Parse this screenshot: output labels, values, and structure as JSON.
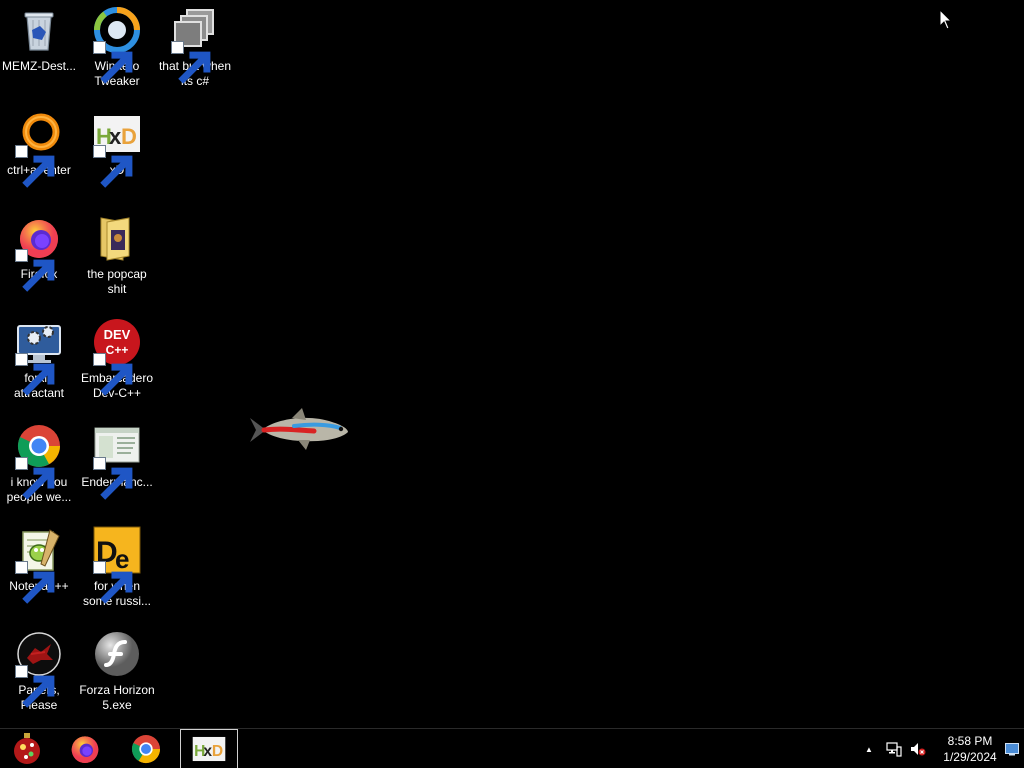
{
  "desktop": {
    "icons": [
      {
        "label": "MEMZ-Dest...",
        "icon": "recycle-bin-icon"
      },
      {
        "label": "Winaero Tweaker",
        "icon": "winaero-icon"
      },
      {
        "label": "that but when its c#",
        "icon": "multiple-windows-icon"
      },
      {
        "label": "ctrl+a, enter",
        "icon": "orange-ring-icon"
      },
      {
        "label": "xD",
        "icon": "hxd-icon"
      },
      {
        "label": "Firefox",
        "icon": "firefox-icon"
      },
      {
        "label": "the popcap shit",
        "icon": "folder-icon"
      },
      {
        "label": "forkie attractant",
        "icon": "settings-monitor-icon"
      },
      {
        "label": "Embarcadero Dev-C++",
        "icon": "devcpp-icon"
      },
      {
        "label": "i know you people we...",
        "icon": "chrome-icon"
      },
      {
        "label": "Endermanc...",
        "icon": "window-app-icon"
      },
      {
        "label": "Notepad++",
        "icon": "notepadpp-icon"
      },
      {
        "label": "for when some russi...",
        "icon": "de-icon"
      },
      {
        "label": "Papers, Please",
        "icon": "papers-please-icon"
      },
      {
        "label": "Forza Horizon 5.exe",
        "icon": "flash-icon"
      }
    ]
  },
  "taskbar": {
    "buttons": [
      {
        "name": "start-button",
        "icon": "ornament-icon"
      },
      {
        "name": "firefox-taskbar-button",
        "icon": "firefox-icon"
      },
      {
        "name": "chrome-taskbar-button",
        "icon": "chrome-icon"
      },
      {
        "name": "hxd-taskbar-button",
        "icon": "hxd-icon",
        "active": true
      }
    ],
    "tray": {
      "chevron": "▲",
      "network_icon": "network-icon",
      "volume_icon": "volume-muted-icon",
      "time": "8:58 PM",
      "date": "1/29/2024"
    }
  },
  "colors": {
    "desktop_bg": "#000000",
    "taskbar_bg": "#000000",
    "text": "#ffffff"
  }
}
